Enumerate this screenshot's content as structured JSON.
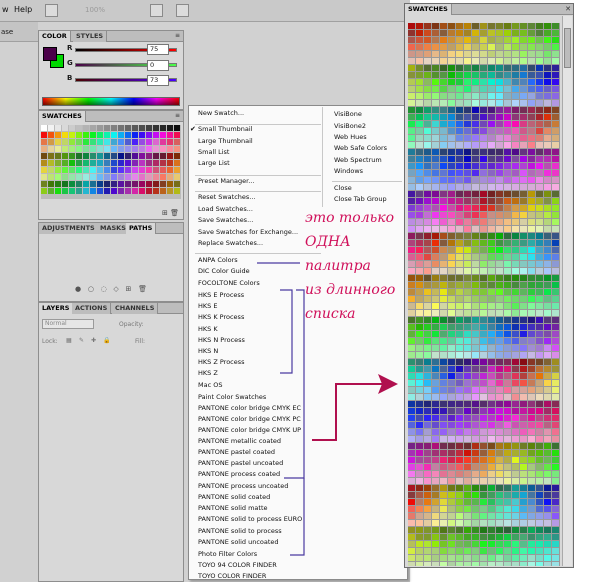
{
  "app": {
    "menubar": [
      "w",
      "Help"
    ],
    "zoom": "100%",
    "options_text": "ase"
  },
  "color_panel": {
    "tabs": [
      "COLOR",
      "STYLES"
    ],
    "channels": [
      {
        "label": "R",
        "value": "75"
      },
      {
        "label": "G",
        "value": "0"
      },
      {
        "label": "B",
        "value": "73"
      }
    ],
    "foreground": "#4b0049",
    "background": "#00d800"
  },
  "swatches_small": {
    "tab": "SWATCHES"
  },
  "adjust_panel": {
    "tabs": [
      "ADJUSTMENTS",
      "MASKS",
      "PATHS"
    ]
  },
  "layers_panel": {
    "tabs": [
      "LAYERS",
      "ACTIONS",
      "CHANNELS"
    ],
    "blend_mode": "Normal",
    "opacity_label": "Opacity:",
    "lock_label": "Lock:",
    "fill_label": "Fill:"
  },
  "menu": {
    "items": [
      {
        "label": "New Swatch...",
        "checked": false
      },
      {
        "label": "Small Thumbnail",
        "checked": true
      },
      {
        "label": "Large Thumbnail",
        "checked": false
      },
      {
        "label": "Small List",
        "checked": false
      },
      {
        "label": "Large List",
        "checked": false
      },
      {
        "label": "Preset Manager...",
        "checked": false
      },
      {
        "label": "Reset Swatches...",
        "checked": false
      },
      {
        "label": "Load Swatches...",
        "checked": false
      },
      {
        "label": "Save Swatches...",
        "checked": false
      },
      {
        "label": "Save Swatches for Exchange...",
        "checked": false
      },
      {
        "label": "Replace Swatches...",
        "checked": false
      },
      {
        "label": "ANPA Colors",
        "checked": false
      },
      {
        "label": "DIC Color Guide",
        "checked": false
      },
      {
        "label": "FOCOLTONE Colors",
        "checked": false
      },
      {
        "label": "HKS E Process",
        "checked": false
      },
      {
        "label": "HKS E",
        "checked": false
      },
      {
        "label": "HKS K Process",
        "checked": false
      },
      {
        "label": "HKS K",
        "checked": false
      },
      {
        "label": "HKS N Process",
        "checked": false
      },
      {
        "label": "HKS N",
        "checked": false
      },
      {
        "label": "HKS Z Process",
        "checked": false
      },
      {
        "label": "HKS Z",
        "checked": false
      },
      {
        "label": "Mac OS",
        "checked": false
      },
      {
        "label": "Paint Color Swatches",
        "checked": false
      },
      {
        "label": "PANTONE color bridge CMYK EC",
        "checked": false
      },
      {
        "label": "PANTONE color bridge CMYK PC",
        "checked": false
      },
      {
        "label": "PANTONE color bridge CMYK UP",
        "checked": false
      },
      {
        "label": "PANTONE metallic coated",
        "checked": false
      },
      {
        "label": "PANTONE pastel coated",
        "checked": false
      },
      {
        "label": "PANTONE pastel uncoated",
        "checked": false
      },
      {
        "label": "PANTONE process coated",
        "checked": false
      },
      {
        "label": "PANTONE process uncoated",
        "checked": false
      },
      {
        "label": "PANTONE solid coated",
        "checked": false
      },
      {
        "label": "PANTONE solid matte",
        "checked": false
      },
      {
        "label": "PANTONE solid to process EURO",
        "checked": false
      },
      {
        "label": "PANTONE solid to process",
        "checked": false
      },
      {
        "label": "PANTONE solid uncoated",
        "checked": false
      },
      {
        "label": "Photo Filter Colors",
        "checked": false
      },
      {
        "label": "TOYO 94 COLOR FINDER",
        "checked": false
      },
      {
        "label": "TOYO COLOR FINDER",
        "checked": false
      }
    ],
    "column2": [
      "VisiBone",
      "VisiBone2",
      "Web Hues",
      "Web Safe Colors",
      "Web Spectrum",
      "Windows",
      "Close",
      "Close Tab Group"
    ]
  },
  "annotation": {
    "lines": [
      "это только",
      "ОДНА",
      "палитра",
      "из длинного",
      "списка"
    ],
    "color": "#d0105a"
  },
  "swatches_large": {
    "tab": "SWATCHES",
    "close": "✕"
  },
  "icons": {
    "swatch_new": "new-swatch-icon",
    "swatch_delete": "trash-icon",
    "panel_menu": "panel-menu-icon",
    "scroll_arrow": "scroll-arrow-icon"
  }
}
